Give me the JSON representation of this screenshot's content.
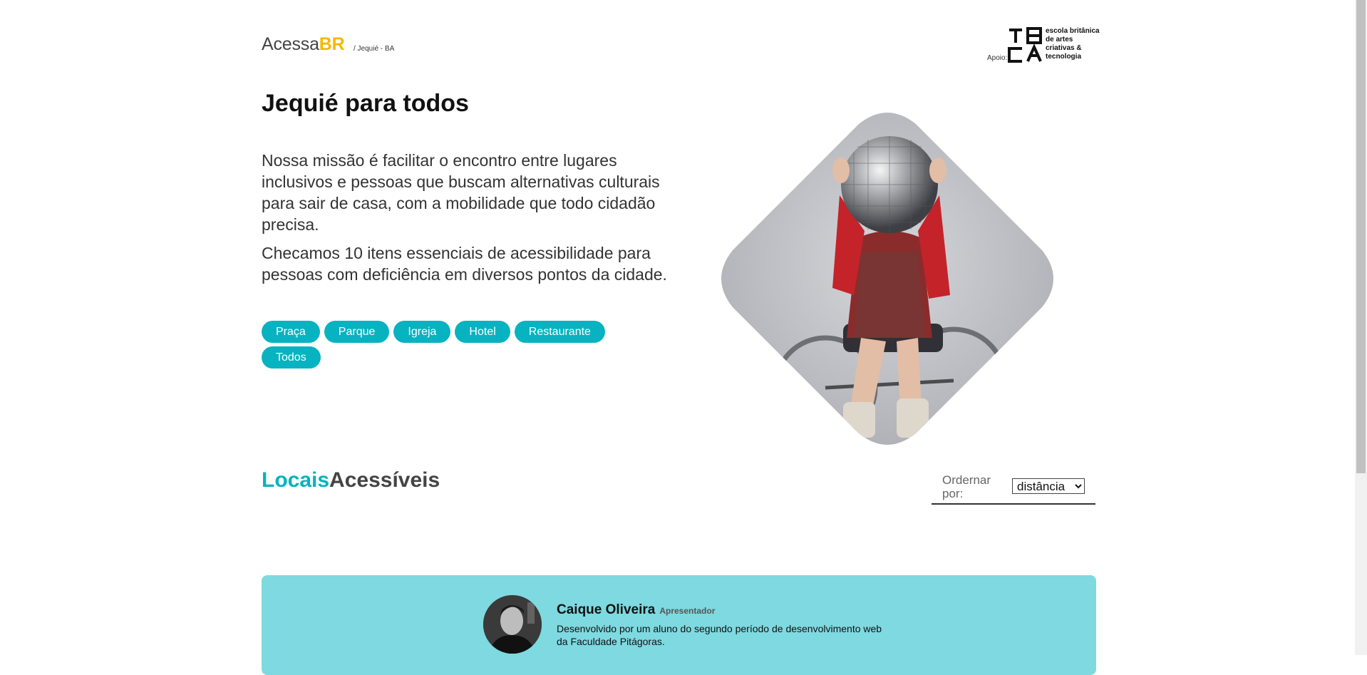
{
  "header": {
    "logo_part1": "Acessa",
    "logo_part2": "BR",
    "breadcrumb": "/ Jequié - BA",
    "support_label": "Apoio:",
    "support_school": "escola britânica de artes criativas & tecnologia"
  },
  "hero": {
    "title": "Jequié para todos",
    "paragraph1": "Nossa missão é facilitar o encontro entre lugares inclusivos e pessoas que buscam alternativas culturais para sair de casa, com a mobilidade que todo cidadão precisa.",
    "paragraph2": "Checamos 10 itens essenciais de acessibilidade para pessoas com deficiência em diversos pontos da cidade.",
    "filters": [
      "Praça",
      "Parque",
      "Igreja",
      "Hotel",
      "Restaurante",
      "Todos"
    ]
  },
  "section": {
    "title_accent": "Locais",
    "title_rest": "Acessíveis",
    "sort_label": "Ordernar por:",
    "sort_value": "distância"
  },
  "credits": {
    "name": "Caique Oliveira",
    "role": "Apresentador",
    "bio": "Desenvolvido por um aluno do segundo período de desenvolvimento web da Faculdade Pitágoras."
  },
  "colors": {
    "accent": "#07b3c0",
    "logo_accent": "#f5b800",
    "card_background": "#7ed9e0"
  }
}
